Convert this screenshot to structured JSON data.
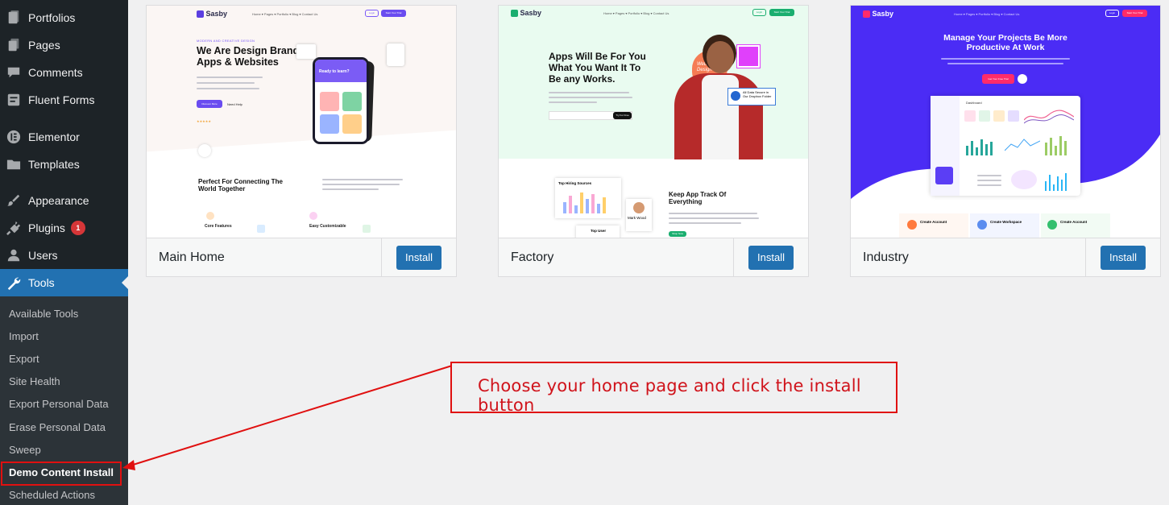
{
  "sidebar": {
    "menu": [
      {
        "label": "Portfolios",
        "icon": "portfolio-icon"
      },
      {
        "label": "Pages",
        "icon": "pages-icon"
      },
      {
        "label": "Comments",
        "icon": "comments-icon"
      },
      {
        "label": "Fluent Forms",
        "icon": "forms-icon"
      },
      {
        "label": "Elementor",
        "icon": "elementor-icon"
      },
      {
        "label": "Templates",
        "icon": "folder-icon"
      },
      {
        "label": "Appearance",
        "icon": "paintbrush-icon"
      },
      {
        "label": "Plugins",
        "icon": "plugin-icon",
        "badge": "1"
      },
      {
        "label": "Users",
        "icon": "users-icon"
      },
      {
        "label": "Tools",
        "icon": "wrench-icon",
        "current": true
      }
    ],
    "submenu": [
      {
        "label": "Available Tools"
      },
      {
        "label": "Import"
      },
      {
        "label": "Export"
      },
      {
        "label": "Site Health"
      },
      {
        "label": "Export Personal Data"
      },
      {
        "label": "Erase Personal Data"
      },
      {
        "label": "Sweep"
      },
      {
        "label": "Demo Content Install",
        "active": true
      },
      {
        "label": "Scheduled Actions"
      }
    ]
  },
  "demos": [
    {
      "name": "Main Home",
      "install_label": "Install",
      "preview": {
        "logo": "Sasby",
        "nav": "Home ▾   Pages ▾   Portfolio ▾   Blog ▾   Contact Us",
        "login": "Login",
        "cta": "Start Your Trial",
        "kicker": "MODERN AND CREATIVE DESIGN",
        "headline": "We Are Design Brands, Apps & Websites",
        "hero_btn": "Discover More",
        "link": "Need Help",
        "phone_text": "Ready to learn?",
        "section_title": "Perfect For Connecting The World Together",
        "features": [
          "Core Features",
          "Easy Customizable"
        ]
      }
    },
    {
      "name": "Factory",
      "install_label": "Install",
      "preview": {
        "logo": "Sasby",
        "nav": "Home ▾   Pages ▾   Portfolio ▾   Blog ▾   Contact Us",
        "login": "Login",
        "cta": "Start Your Trial",
        "headline": "Apps Will Be For You What You Want It To Be any Works.",
        "input_btn": "Try For Free",
        "badge_text": "Web Design",
        "secure_text": "All Data Secure in Our Dropbox Folder",
        "card_title": "Top Hiring Sources",
        "person": "Mark Wood",
        "top_user": "Top User",
        "section_title": "Keep App Track Of Everything",
        "section_btn": "Shop Now"
      }
    },
    {
      "name": "Industry",
      "install_label": "Install",
      "preview": {
        "logo": "Sasby",
        "nav": "Home ▾   Pages ▾   Portfolio ▾   Blog ▾   Contact Us",
        "login": "Login",
        "cta": "Start Your Trial",
        "headline": "Manage Your Projects Be More Productive At Work",
        "hero_btn": "Get Your Free Trial",
        "dash_title": "Dashboard",
        "steps": [
          "Create Account",
          "Create Workspace",
          "Create Account"
        ]
      }
    }
  ],
  "callout": {
    "text": "Choose your home page and click the install button"
  },
  "colors": {
    "sidebar_bg": "#1d2327",
    "submenu_bg": "#2c3338",
    "accent": "#2271b1",
    "annotation": "#e01010"
  }
}
